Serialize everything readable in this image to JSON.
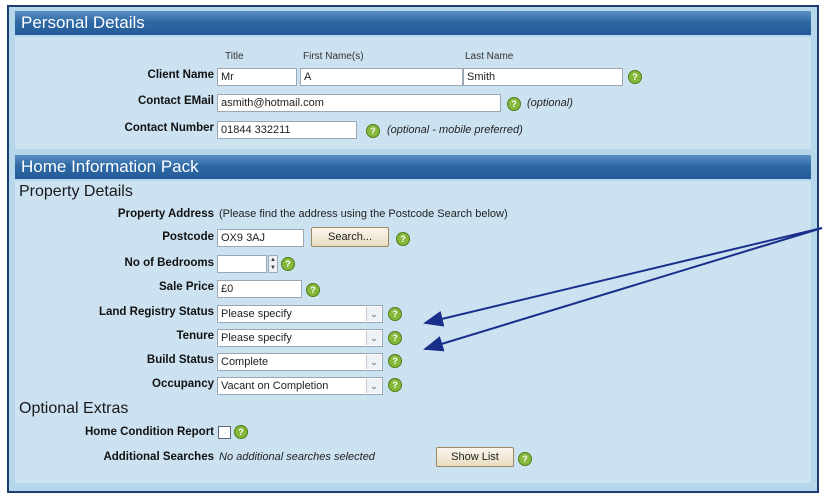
{
  "personal": {
    "section_title": "Personal Details",
    "col_title": "Title",
    "col_first": "First Name(s)",
    "col_last": "Last Name",
    "client_name_label": "Client Name",
    "title_value": "Mr",
    "first_value": "A",
    "last_value": "Smith",
    "email_label": "Contact EMail",
    "email_value": "asmith@hotmail.com",
    "email_note": "(optional)",
    "number_label": "Contact Number",
    "number_value": "01844 332211",
    "number_note": "(optional - mobile preferred)"
  },
  "hip": {
    "section_title": "Home Information Pack",
    "property_heading": "Property Details",
    "address_label": "Property Address",
    "address_note": "(Please find the address using the Postcode Search below)",
    "postcode_label": "Postcode",
    "postcode_value": "OX9 3AJ",
    "search_button": "Search...",
    "bedrooms_label": "No of Bedrooms",
    "bedrooms_value": "",
    "stepper_up": "▲",
    "stepper_down": "▼",
    "sale_price_label": "Sale Price",
    "sale_price_value": "£0",
    "land_registry_label": "Land Registry Status",
    "land_registry_value": "Please specify",
    "tenure_label": "Tenure",
    "tenure_value": "Please specify",
    "build_status_label": "Build Status",
    "build_status_value": "Complete",
    "occupancy_label": "Occupancy",
    "occupancy_value": "Vacant on Completion",
    "extras_heading": "Optional Extras",
    "hcr_label": "Home Condition Report",
    "additional_label": "Additional Searches",
    "additional_note": "No additional searches selected",
    "show_list_button": "Show List"
  },
  "icons": {
    "help": "?",
    "dropdown": "⌄"
  },
  "colors": {
    "section_bar": "#2e69a6",
    "panel": "#cce2f1",
    "background": "#b6d6ea",
    "help_icon": "#86b83b",
    "annotation_arrow": "#1a2f8c"
  }
}
